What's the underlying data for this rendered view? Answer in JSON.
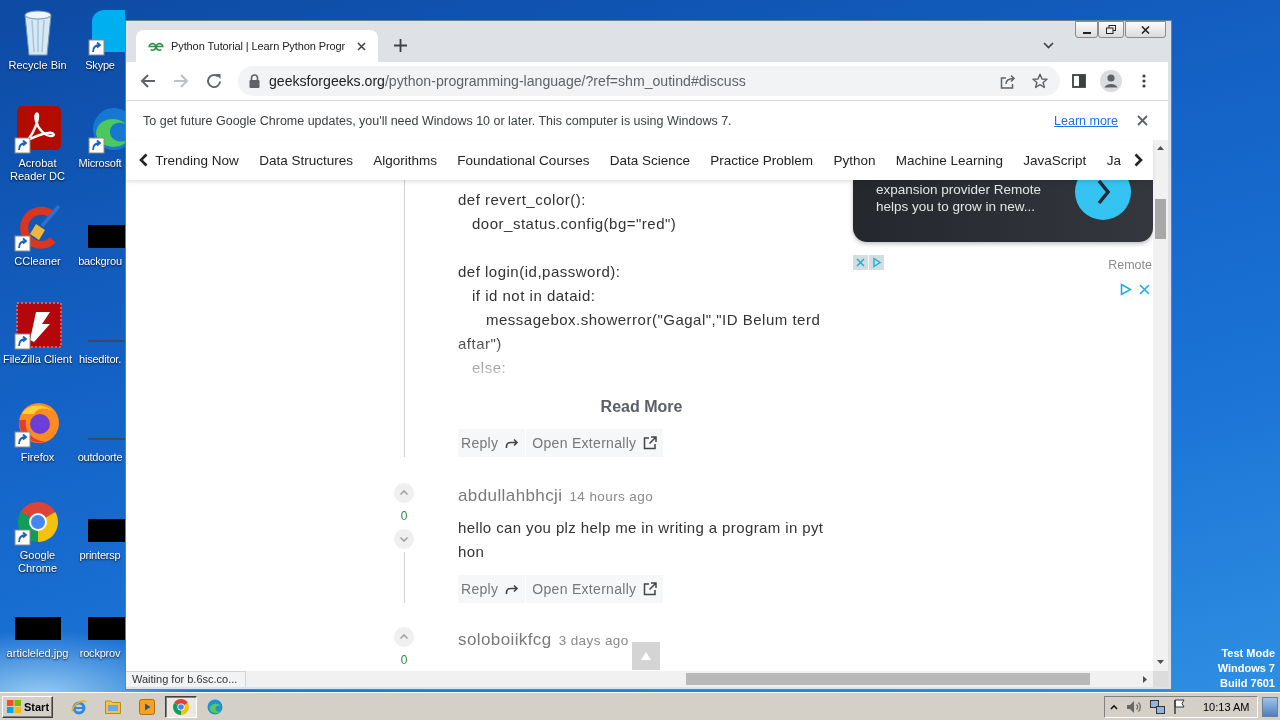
{
  "desktop": {
    "icons": [
      {
        "label": "Recycle Bin",
        "kind": "bin"
      },
      {
        "label": "Skype",
        "kind": "chat"
      },
      {
        "label": "Acrobat Reader DC",
        "kind": "pdf"
      },
      {
        "label": "Microsoft",
        "kind": "edge"
      },
      {
        "label": "CCleaner",
        "kind": "cleaner"
      },
      {
        "label": "backgrou",
        "kind": "image"
      },
      {
        "label": "FileZilla Client",
        "kind": "ftp"
      },
      {
        "label": "hiseditor.",
        "kind": "line"
      },
      {
        "label": "Firefox",
        "kind": "firefox"
      },
      {
        "label": "outdoorte",
        "kind": "line"
      },
      {
        "label": "Google Chrome",
        "kind": "chrome"
      },
      {
        "label": "printersp",
        "kind": "image"
      },
      {
        "label": "articleled.jpg",
        "kind": "image"
      },
      {
        "label": "rockprov",
        "kind": "image"
      }
    ],
    "system_notice": [
      "Test Mode",
      "Windows 7",
      "Build 7601"
    ]
  },
  "browser": {
    "tabs": [
      {
        "title": "Python Tutorial | Learn Python Progr",
        "selected": true
      }
    ],
    "nav_buttons": [
      {
        "kind": "back",
        "disabled": false
      },
      {
        "kind": "forward",
        "disabled": true
      },
      {
        "kind": "reload",
        "disabled": false
      }
    ],
    "address": {
      "host": "geeksforgeeks.org",
      "path": "/python-programming-language/?ref=shm_outind#discuss"
    },
    "infobar": {
      "message": "To get future Google Chrome updates, you'll need Windows 10 or later. This computer is using Windows 7.",
      "link": "Learn more"
    },
    "status": "Waiting for b.6sc.co..."
  },
  "page": {
    "nav_menu": [
      "Trending Now",
      "Data Structures",
      "Algorithms",
      "Foundational Courses",
      "Data Science",
      "Practice Problem",
      "Python",
      "Machine Learning",
      "JavaScript",
      "Ja"
    ],
    "comments": [
      {
        "code_blocks": [
          [
            "def revert_color():",
            "   door_status.config(bg=\"red\")"
          ],
          [
            "def login(id,password):",
            "   if id not in dataid:",
            "      messagebox.showerror(\"Gagal\",\"ID Belum terdaftar\")",
            "   else:"
          ]
        ],
        "read_more": "Read More",
        "actions": [
          {
            "label": "Reply",
            "kind": "reply"
          },
          {
            "label": "Open Externally",
            "kind": "external"
          }
        ]
      },
      {
        "votes": "0",
        "author": "abdullahbhcji",
        "time": "14 hours ago",
        "text": "hello can you plz help me in writing a program in python",
        "actions": [
          {
            "label": "Reply",
            "kind": "reply"
          },
          {
            "label": "Open Externally",
            "kind": "external"
          }
        ]
      },
      {
        "votes": "0",
        "author": "soloboiikfcg",
        "time": "3 days ago"
      }
    ],
    "ad": {
      "text": "expansion provider Remote helps you to grow in new...",
      "advertiser": "Remote"
    }
  },
  "taskbar": {
    "start": "Start",
    "apps": [
      {
        "kind": "ie",
        "selected": false
      },
      {
        "kind": "explorer",
        "selected": false
      },
      {
        "kind": "media",
        "selected": false
      },
      {
        "kind": "chrome",
        "selected": true
      },
      {
        "kind": "edge",
        "selected": false
      }
    ],
    "clock": "10:13 AM"
  }
}
